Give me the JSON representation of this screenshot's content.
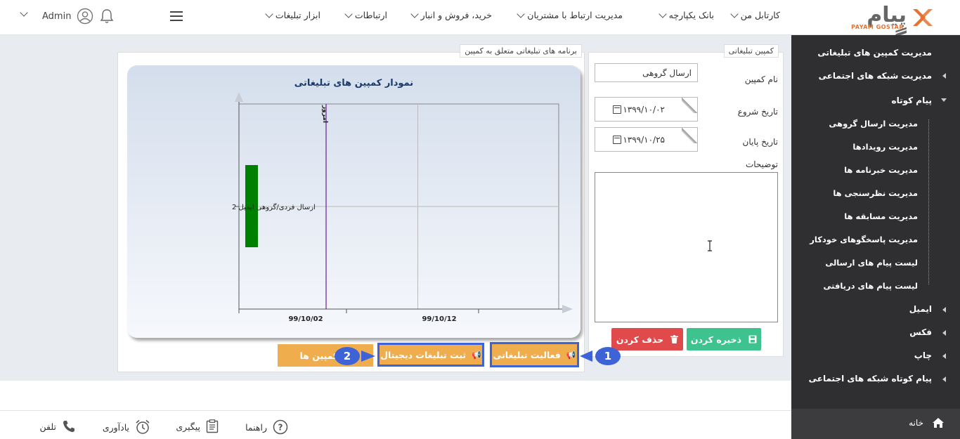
{
  "header": {
    "logo_text": "پیام گستر",
    "logo_subtext": "PAYAM GOSTAR",
    "nav": [
      "کارتابل من",
      "بانک یکپارچه",
      "مدیریت ارتباط با مشتریان",
      "خرید، فروش و انبار",
      "ارتباطات",
      "ابزار تبلیغات"
    ],
    "user": "Admin"
  },
  "sidebar": {
    "items": [
      {
        "label": "مدیریت کمپین های تبلیغاتی"
      },
      {
        "label": "مدیریت شبکه های اجتماعی"
      },
      {
        "label": "پیام کوتاه"
      }
    ],
    "sub_items": [
      "مدیریت ارسال گروهی",
      "مدیریت رویدادها",
      "مدیریت خبرنامه ها",
      "مدیریت نظرسنجی ها",
      "مدیریت مسابقه ها",
      "مدیریت پاسخگوهای خودکار",
      "لیست پیام های ارسالی",
      "لیست پیام های دریافتی"
    ],
    "bottom_items": [
      "ایمیل",
      "فکس",
      "چاپ",
      "پیام کوتاه شبکه های اجتماعی"
    ],
    "home": "خانه"
  },
  "form": {
    "legend": "کمپین تبلیغاتی",
    "name_label": "نام کمپین",
    "name_value": "ارسال گروهی",
    "start_label": "تاریخ شروع",
    "start_value": "۱۳۹۹/۱۰/۰۲",
    "end_label": "تاریخ پایان",
    "end_value": "۱۳۹۹/۱۰/۲۵",
    "desc_label": "توضیحات",
    "save": "ذخیره کردن",
    "delete": "حذف کردن"
  },
  "chart_panel": {
    "legend": "برنامه های تبلیغاتی متعلق به کمپین",
    "btn_activity": "فعالیت تبلیغاتی",
    "btn_digital": "ثبت تبلیغات دیجیتال",
    "btn_campaigns": "ده کمپین ها",
    "badge1": "1",
    "badge2": "2"
  },
  "chart_data": {
    "type": "bar",
    "title": "نمودار کمپین های تبلیغاتی",
    "categories": [
      "ارسال فردی/گروهی ایمیل 2"
    ],
    "x_ticks": [
      "99/10/02",
      "99/10/12"
    ],
    "today_label": "امروز",
    "series": [
      {
        "values": [
          [
            1,
            3
          ]
        ]
      }
    ],
    "colors": {
      "bar": "#008000",
      "today_line": "#6a1b9a"
    }
  },
  "footer": {
    "help": "راهنما",
    "followup": "پیگیری",
    "reminder": "یادآوری",
    "phone": "تلفن"
  }
}
